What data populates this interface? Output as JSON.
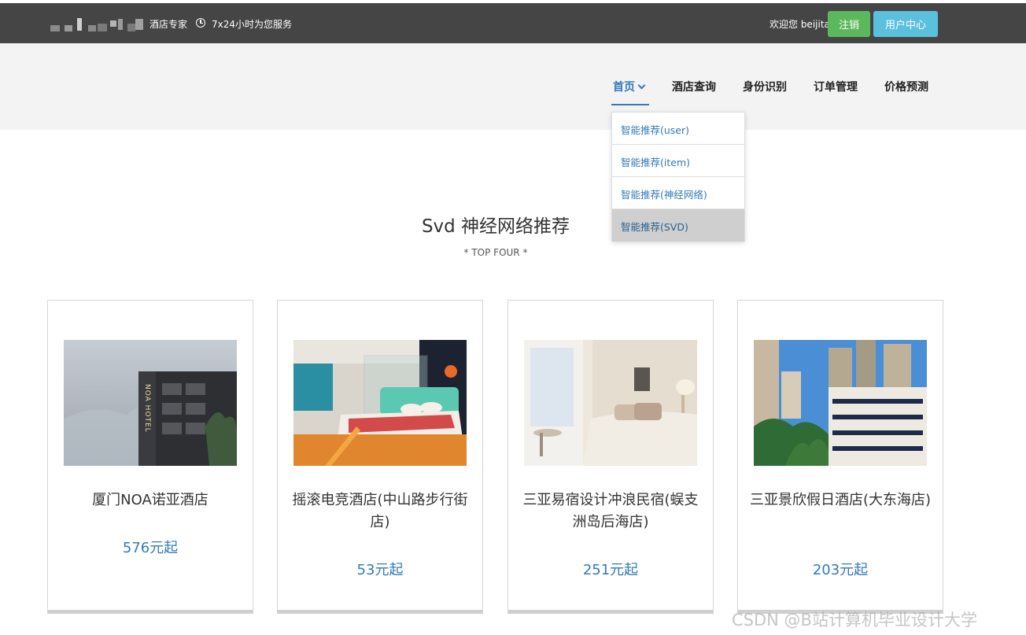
{
  "topbar": {
    "logo_text": "酒店专家",
    "service": "7x24小时为您服务",
    "welcome": "欢迎您 beijita",
    "logout_label": "注销",
    "user_center_label": "用户中心"
  },
  "nav": {
    "items": [
      "首页",
      "酒店查询",
      "身份识别",
      "订单管理",
      "价格预测"
    ]
  },
  "dropdown": {
    "items": [
      "智能推荐(user)",
      "智能推荐(item)",
      "智能推荐(神经网络)",
      "智能推荐(SVD)"
    ]
  },
  "section": {
    "title": "Svd 神经网络推荐",
    "subtitle": "* TOP FOUR *"
  },
  "hotels": [
    {
      "name": "厦门NOA诺亚酒店",
      "price": "576元起"
    },
    {
      "name": "摇滚电竞酒店(中山路步行街店)",
      "price": "53元起"
    },
    {
      "name": "三亚易宿设计冲浪民宿(蜈支洲岛后海店)",
      "price": "251元起"
    },
    {
      "name": "三亚景欣假日酒店(大东海店)",
      "price": "203元起"
    }
  ],
  "watermark": "CSDN @B站计算机毕业设计大学"
}
